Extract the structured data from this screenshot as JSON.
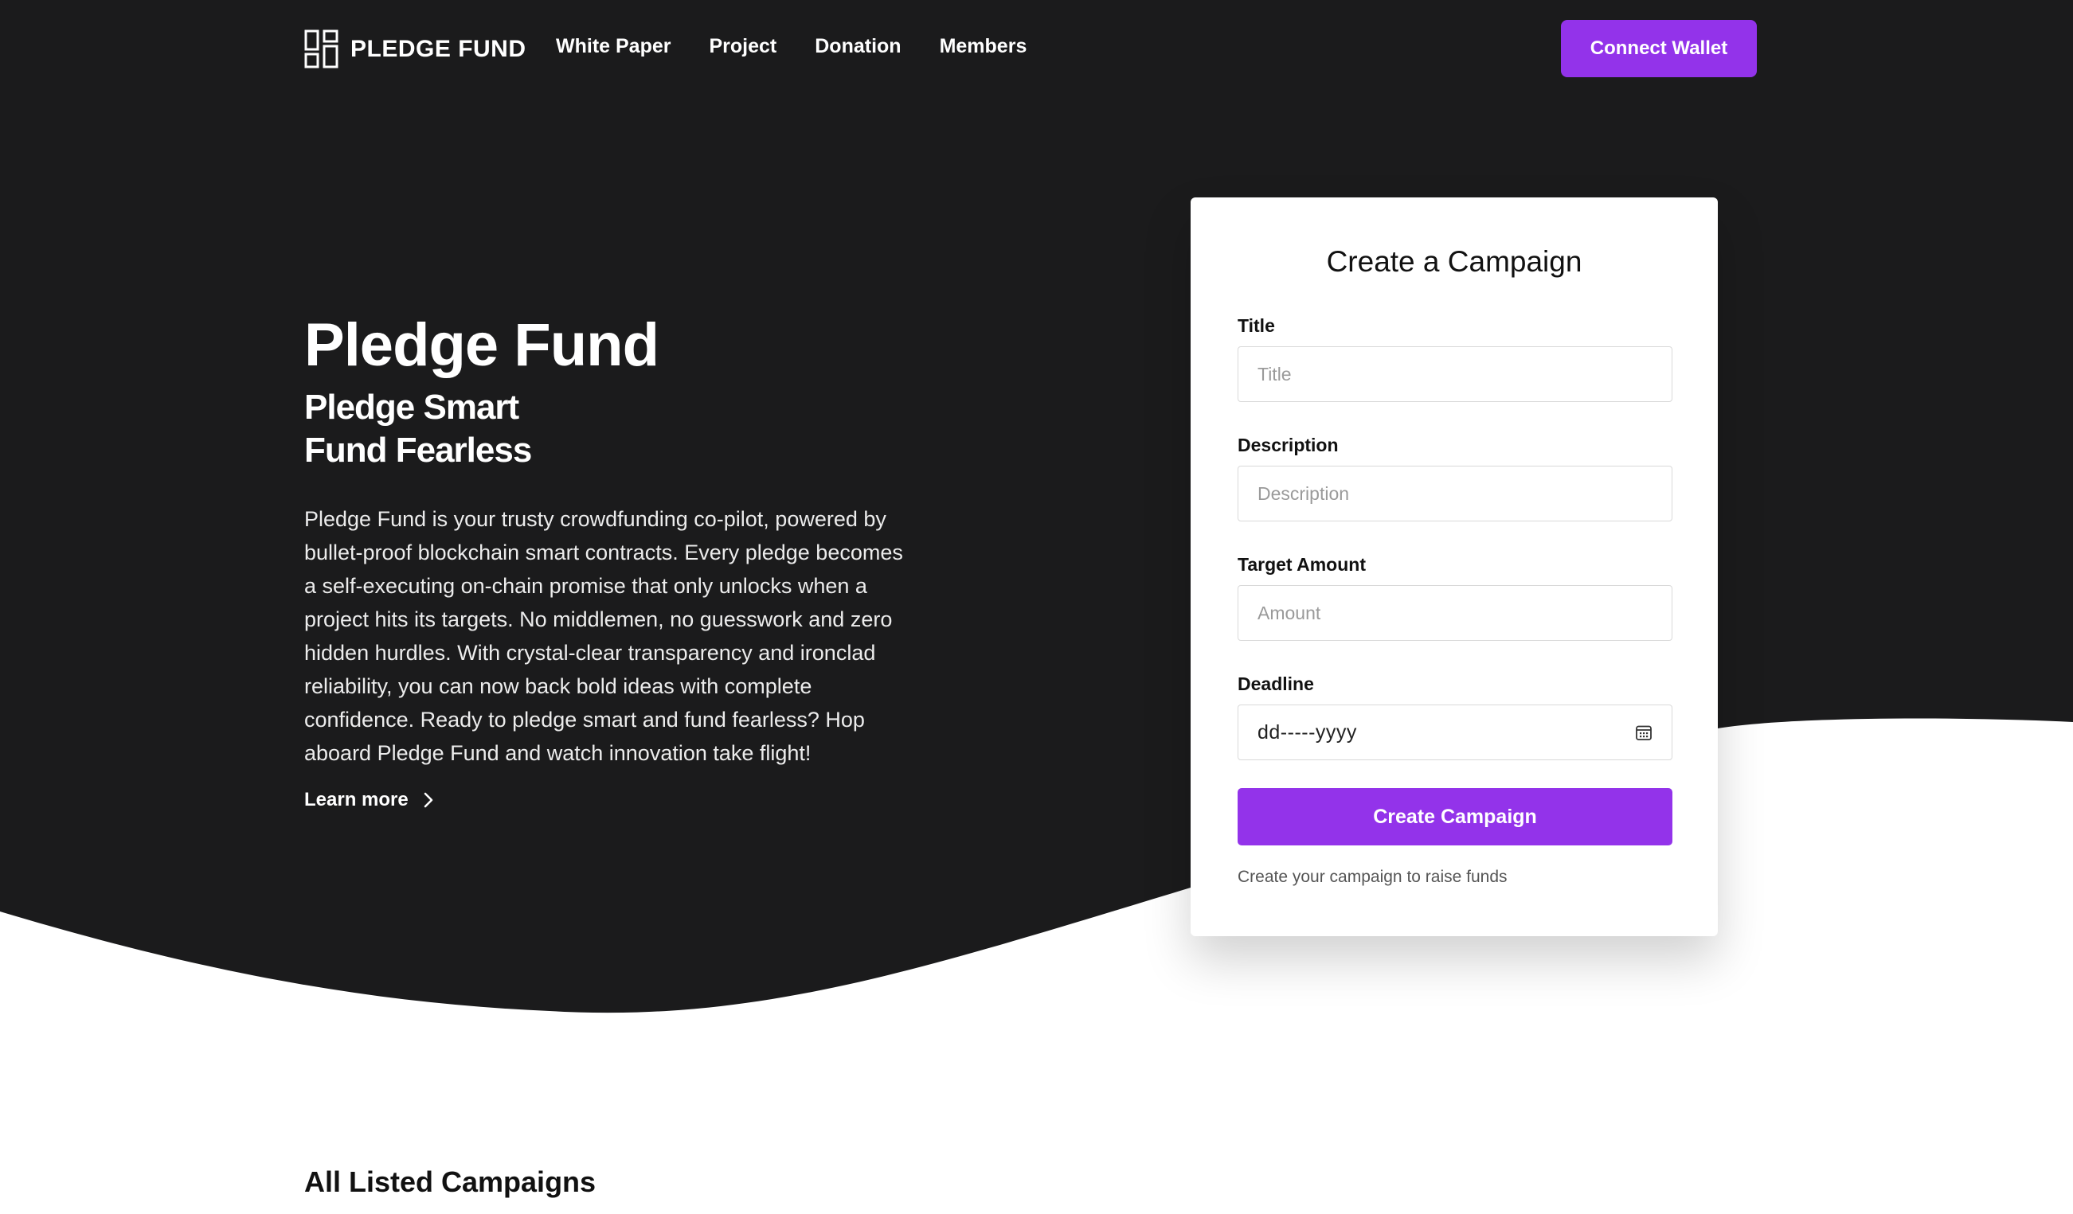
{
  "colors": {
    "hero_bg": "#1b1b1c",
    "accent": "#9333ea",
    "page_bg": "#ffffff"
  },
  "nav": {
    "logo_icon": "grid-blocks-icon",
    "brand": "PLEDGE FUND",
    "links": [
      "White Paper",
      "Project",
      "Donation",
      "Members"
    ],
    "connect_label": "Connect Wallet"
  },
  "hero": {
    "title": "Pledge Fund",
    "subtitle_line1": "Pledge Smart",
    "subtitle_line2": "Fund Fearless",
    "description": "Pledge Fund is your trusty crowdfunding co-pilot, powered by bullet-proof blockchain smart contracts. Every pledge becomes a self-executing on-chain promise that only unlocks when a project hits its targets. No middlemen, no guesswork and zero hidden hurdles. With crystal-clear transparency and ironclad reliability, you can now back bold ideas with complete confidence. Ready to pledge smart and fund fearless? Hop aboard Pledge Fund and watch innovation take flight!",
    "learn_more": "Learn more"
  },
  "form": {
    "heading": "Create a Campaign",
    "title_label": "Title",
    "title_placeholder": "Title",
    "description_label": "Description",
    "description_placeholder": "Description",
    "amount_label": "Target Amount",
    "amount_placeholder": "Amount",
    "deadline_label": "Deadline",
    "deadline_value": "dd-----yyyy",
    "submit_label": "Create Campaign",
    "helper": "Create your campaign to raise funds"
  },
  "campaigns": {
    "heading": "All Listed Campaigns"
  }
}
